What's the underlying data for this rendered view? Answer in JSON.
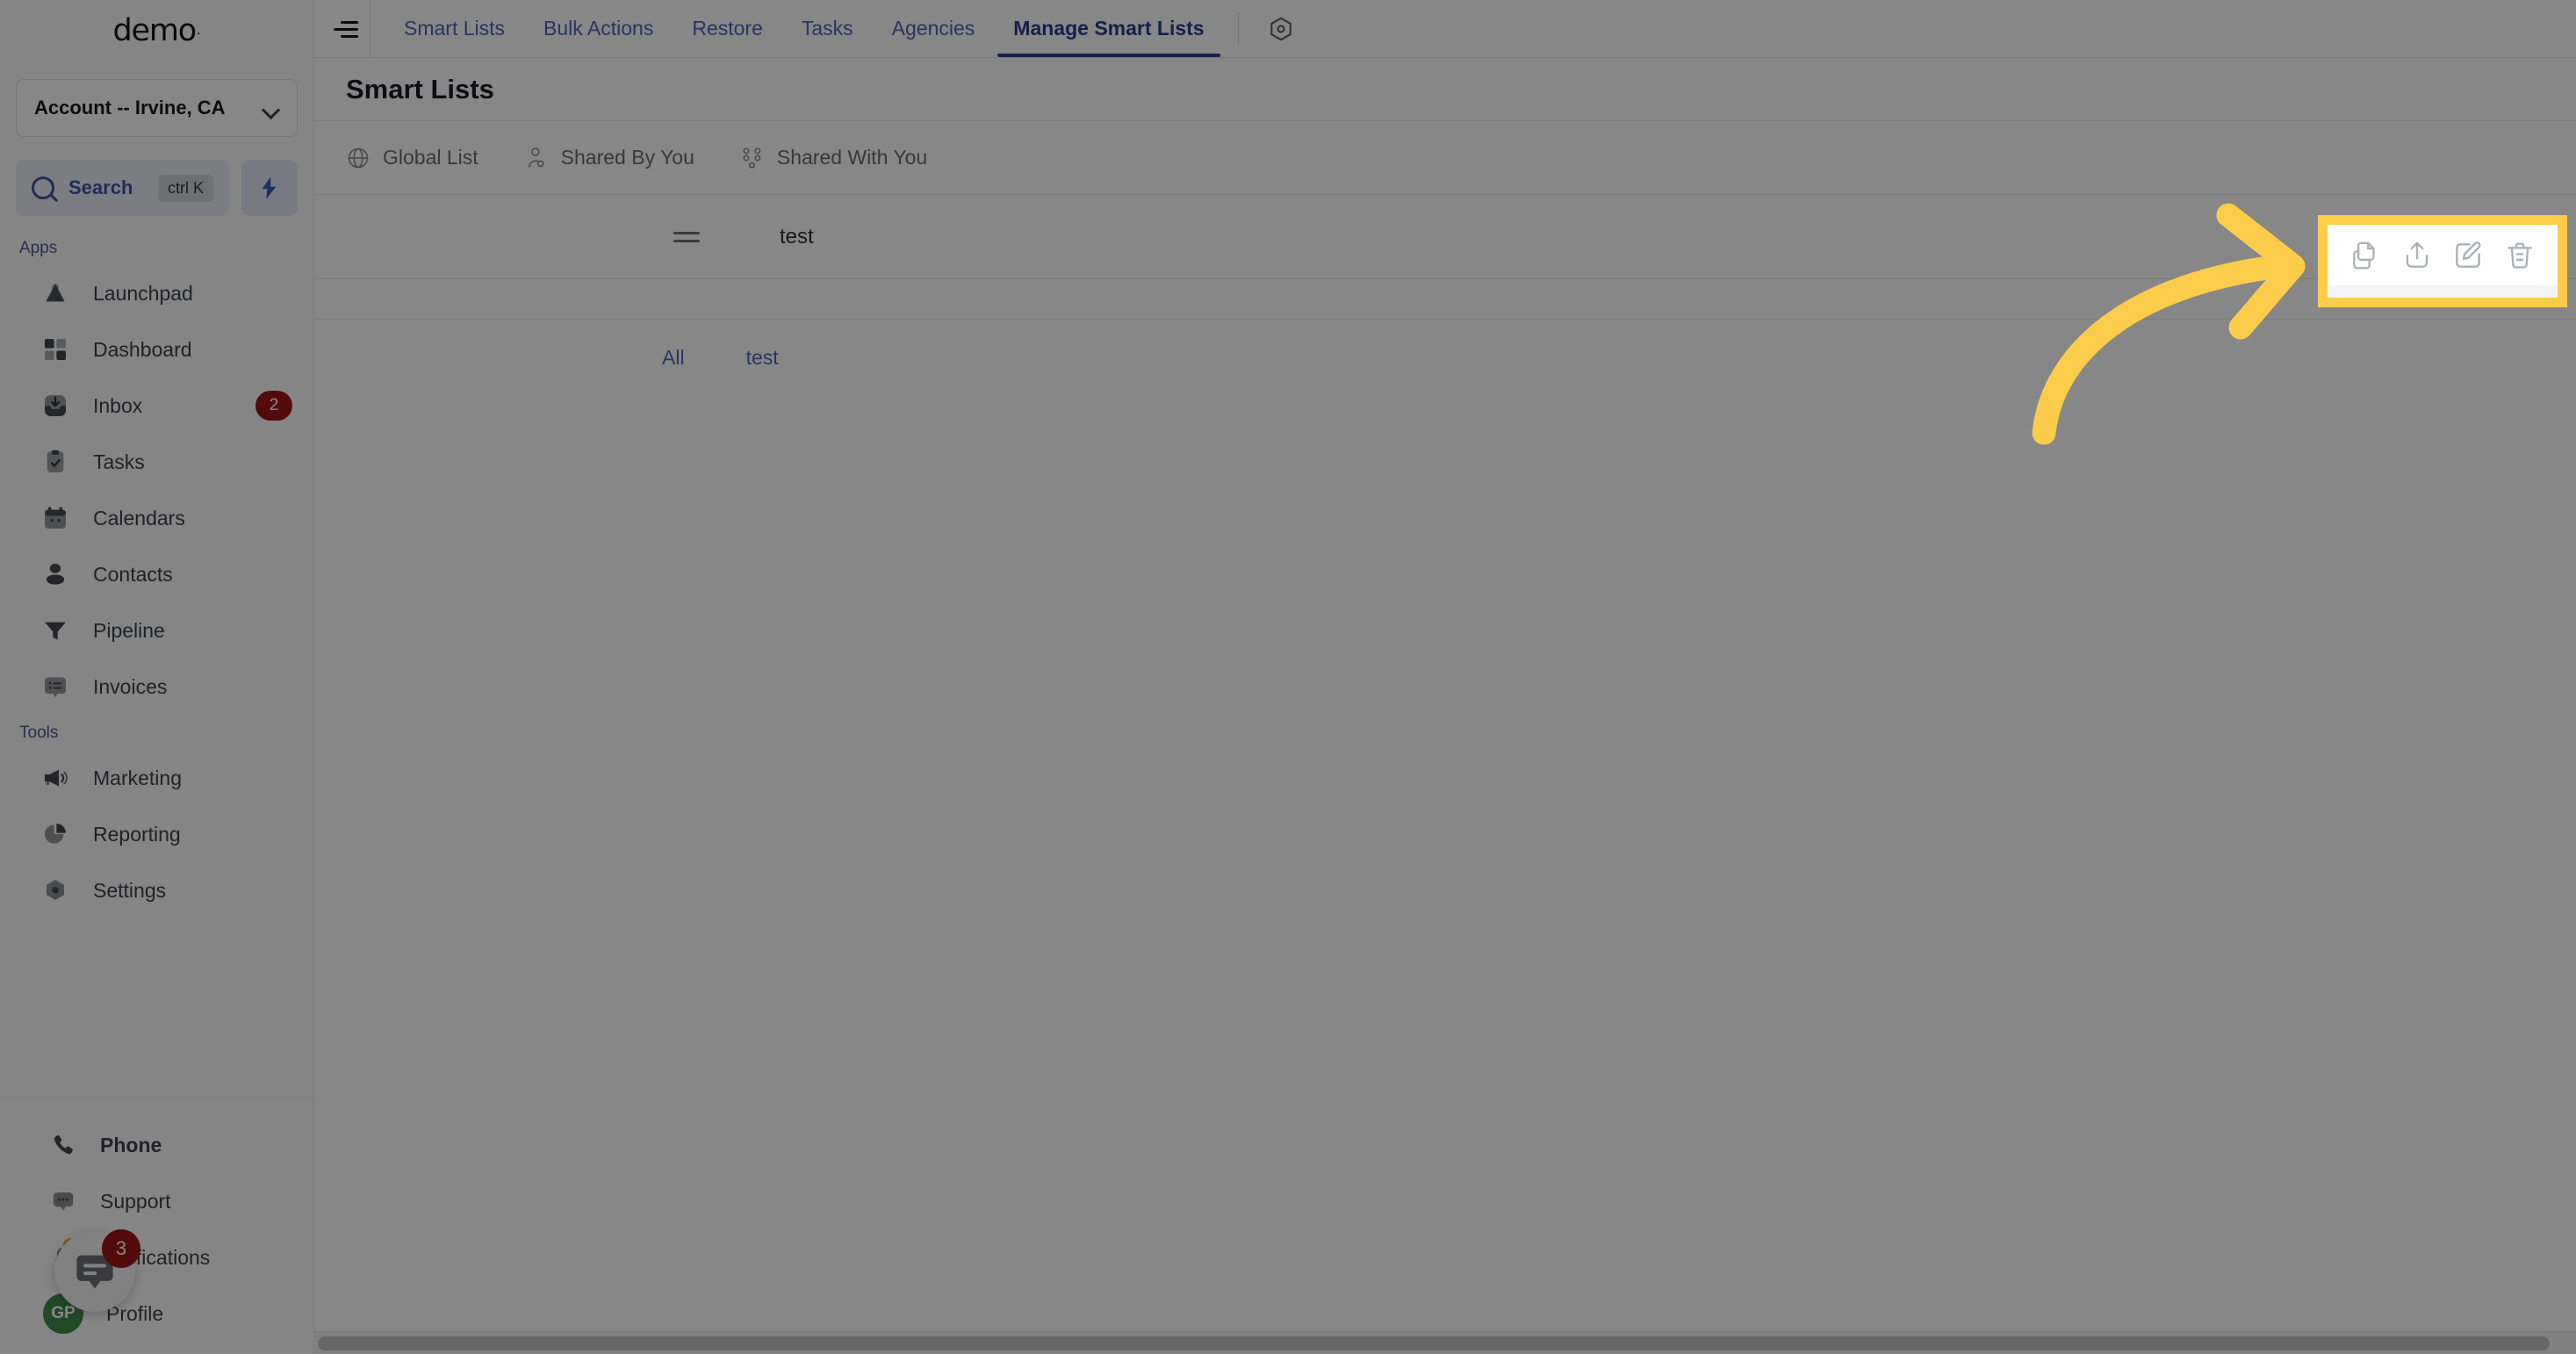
{
  "sidebar": {
    "brand": "demo",
    "brand_dot": ".",
    "account_selector": {
      "label": "Account -- Irvine, CA",
      "icon": "chevron-down-icon"
    },
    "search": {
      "label": "Search",
      "shortcut": "ctrl K",
      "icon": "search-icon"
    },
    "bolt_button": {
      "icon": "lightning-bolt-icon",
      "glyph": "⚡"
    },
    "groups": [
      {
        "title": "Apps",
        "items": [
          {
            "label": "Launchpad",
            "icon": "launchpad-icon",
            "badge": ""
          },
          {
            "label": "Dashboard",
            "icon": "dashboard-grid-icon",
            "badge": ""
          },
          {
            "label": "Inbox",
            "icon": "inbox-icon",
            "badge": "2"
          },
          {
            "label": "Tasks",
            "icon": "clipboard-check-icon",
            "badge": ""
          },
          {
            "label": "Calendars",
            "icon": "calendar-icon",
            "badge": ""
          },
          {
            "label": "Contacts",
            "icon": "person-icon",
            "badge": ""
          },
          {
            "label": "Pipeline",
            "icon": "funnel-icon",
            "badge": ""
          },
          {
            "label": "Invoices",
            "icon": "invoice-list-icon",
            "badge": ""
          }
        ]
      },
      {
        "title": "Tools",
        "items": [
          {
            "label": "Marketing",
            "icon": "megaphone-icon",
            "badge": ""
          },
          {
            "label": "Reporting",
            "icon": "pie-chart-icon",
            "badge": ""
          },
          {
            "label": "Settings",
            "icon": "gear-icon",
            "badge": ""
          }
        ]
      }
    ],
    "footer": [
      {
        "label": "Phone",
        "icon": "phone-icon",
        "badge": ""
      },
      {
        "label": "Support",
        "icon": "chat-bubble-icon",
        "badge": ""
      },
      {
        "label": "Notifications",
        "icon": "bell-icon",
        "badge": ""
      },
      {
        "label": "Profile",
        "icon": "avatar-icon",
        "badge": ""
      }
    ],
    "profile_initials": "GP"
  },
  "chat_widget": {
    "icon": "chat-widget-icon",
    "unread_count": "3"
  },
  "topbar": {
    "collapse_icon": "collapse-menu-icon",
    "tabs": [
      {
        "label": "Smart Lists",
        "active": false
      },
      {
        "label": "Bulk Actions",
        "active": false
      },
      {
        "label": "Restore",
        "active": false
      },
      {
        "label": "Tasks",
        "active": false
      },
      {
        "label": "Agencies",
        "active": false
      },
      {
        "label": "Manage Smart Lists",
        "active": true
      }
    ],
    "settings_icon": "hexagon-settings-icon"
  },
  "page": {
    "title": "Smart Lists",
    "filters": [
      {
        "label": "Global List",
        "icon": "globe-icon"
      },
      {
        "label": "Shared By You",
        "icon": "user-shared-icon"
      },
      {
        "label": "Shared With You",
        "icon": "users-network-icon"
      }
    ],
    "rows": [
      {
        "drag_icon": "drag-handle-icon",
        "name": "test",
        "actions": [
          {
            "name": "duplicate-list-button",
            "icon": "copy-documents-icon"
          },
          {
            "name": "share-list-button",
            "icon": "share-upload-icon"
          },
          {
            "name": "edit-list-button",
            "icon": "pencil-edit-icon"
          },
          {
            "name": "delete-list-button",
            "icon": "trash-delete-icon"
          }
        ]
      }
    ],
    "sublist_links": [
      {
        "label": "All"
      },
      {
        "label": "test"
      }
    ]
  },
  "annotation": {
    "arrow_color": "#fbcd4a",
    "highlight_border_color": "#fbcd4a",
    "shape": "curved-arrow-pointing-right"
  }
}
